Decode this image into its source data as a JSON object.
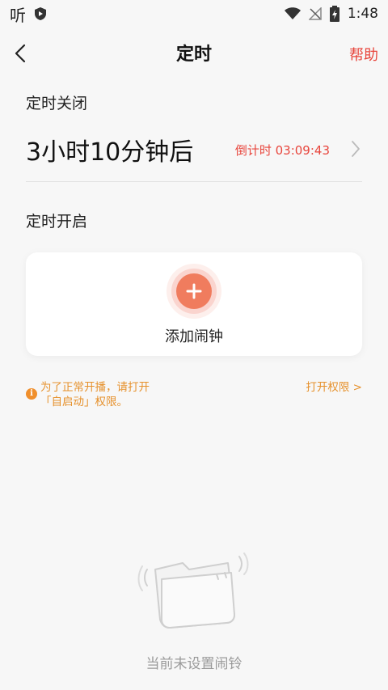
{
  "status_bar": {
    "app_glyph": "听",
    "time": "1:48",
    "icons": [
      "shield-play-icon",
      "wifi-icon",
      "no-signal-icon",
      "battery-charging-icon"
    ]
  },
  "appbar": {
    "title": "定时",
    "help": "帮助"
  },
  "timer_off": {
    "section_title": "定时关闭",
    "value": "3小时10分钟后",
    "countdown": "倒计时 03:09:43"
  },
  "timer_on": {
    "section_title": "定时开启",
    "add_alarm_label": "添加闹钟"
  },
  "notice": {
    "line1": "为了正常开播，请打开",
    "line2": "「自启动」权限。",
    "link": "打开权限 >"
  },
  "empty_state": {
    "text": "当前未设置闹铃"
  },
  "colors": {
    "accent_red": "#e8453c",
    "add_button": "#f07c5e",
    "notice_orange": "#e6912c",
    "background": "#f7f7f7"
  }
}
